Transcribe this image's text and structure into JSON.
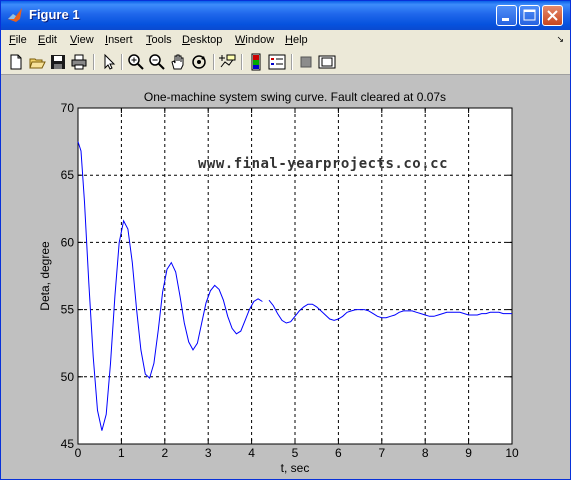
{
  "window": {
    "title": "Figure 1"
  },
  "menubar": {
    "items": [
      {
        "label": "File",
        "mnemonic": "F",
        "rest": "ile"
      },
      {
        "label": "Edit",
        "mnemonic": "E",
        "rest": "dit"
      },
      {
        "label": "View",
        "mnemonic": "V",
        "rest": "iew"
      },
      {
        "label": "Insert",
        "mnemonic": "I",
        "rest": "nsert"
      },
      {
        "label": "Tools",
        "mnemonic": "T",
        "rest": "ools"
      },
      {
        "label": "Desktop",
        "mnemonic": "D",
        "rest": "esktop"
      },
      {
        "label": "Window",
        "mnemonic": "W",
        "rest": "indow"
      },
      {
        "label": "Help",
        "mnemonic": "H",
        "rest": "elp"
      }
    ],
    "overflow_icon": "dock-arrow-icon"
  },
  "toolbar": {
    "buttons": [
      "new-figure-icon",
      "open-file-icon",
      "save-icon",
      "print-icon",
      "edit-plot-icon",
      "zoom-in-icon",
      "zoom-out-icon",
      "pan-icon",
      "rotate-3d-icon",
      "data-cursor-icon",
      "colorbar-icon",
      "legend-icon",
      "hide-plot-tools-icon",
      "show-plot-tools-icon"
    ]
  },
  "watermark": "www.final-yearprojects.co.cc",
  "chart_data": {
    "type": "line",
    "title": "One-machine system swing curve. Fault cleared at 0.07s",
    "xlabel": "t, sec",
    "ylabel": "Deta, degree",
    "xlim": [
      0,
      10
    ],
    "ylim": [
      45,
      70
    ],
    "xticks": [
      0,
      1,
      2,
      3,
      4,
      5,
      6,
      7,
      8,
      9,
      10
    ],
    "yticks": [
      45,
      50,
      55,
      60,
      65,
      70
    ],
    "grid": true,
    "line_color": "#0000FF",
    "series": [
      {
        "points": [
          [
            0,
            67.5
          ],
          [
            0.07,
            66.8
          ],
          [
            0.15,
            63.0
          ],
          [
            0.25,
            57.0
          ],
          [
            0.35,
            51.5
          ],
          [
            0.45,
            47.5
          ],
          [
            0.55,
            46.0
          ],
          [
            0.65,
            47.2
          ],
          [
            0.75,
            51.0
          ],
          [
            0.85,
            56.0
          ],
          [
            0.95,
            60.0
          ],
          [
            1.05,
            61.6
          ],
          [
            1.15,
            61.0
          ],
          [
            1.25,
            58.5
          ],
          [
            1.35,
            55.0
          ],
          [
            1.45,
            52.0
          ],
          [
            1.55,
            50.2
          ],
          [
            1.65,
            49.9
          ],
          [
            1.75,
            51.0
          ],
          [
            1.85,
            53.5
          ],
          [
            1.95,
            56.3
          ],
          [
            2.05,
            58.0
          ],
          [
            2.15,
            58.5
          ],
          [
            2.25,
            57.8
          ],
          [
            2.35,
            56.0
          ],
          [
            2.45,
            54.0
          ],
          [
            2.55,
            52.6
          ],
          [
            2.65,
            52.0
          ],
          [
            2.75,
            52.5
          ],
          [
            2.85,
            54.0
          ],
          [
            2.95,
            55.5
          ],
          [
            3.05,
            56.4
          ],
          [
            3.15,
            56.8
          ],
          [
            3.25,
            56.5
          ],
          [
            3.35,
            55.7
          ],
          [
            3.45,
            54.5
          ],
          [
            3.55,
            53.6
          ],
          [
            3.65,
            53.2
          ],
          [
            3.75,
            53.4
          ],
          [
            3.85,
            54.2
          ],
          [
            3.95,
            55.0
          ],
          [
            4.05,
            55.6
          ],
          [
            4.15,
            55.8
          ],
          [
            4.25,
            55.6
          ],
          null,
          [
            4.4,
            55.7
          ],
          [
            4.5,
            55.3
          ],
          [
            4.6,
            54.7
          ],
          [
            4.7,
            54.2
          ],
          [
            4.8,
            54.0
          ],
          [
            4.9,
            54.1
          ],
          [
            5.0,
            54.5
          ],
          [
            5.1,
            54.9
          ],
          [
            5.2,
            55.2
          ],
          [
            5.3,
            55.4
          ],
          [
            5.4,
            55.4
          ],
          [
            5.5,
            55.2
          ],
          [
            5.6,
            54.9
          ],
          [
            5.7,
            54.6
          ],
          [
            5.8,
            54.3
          ],
          [
            5.9,
            54.2
          ],
          [
            6.0,
            54.3
          ],
          [
            6.1,
            54.5
          ],
          [
            6.2,
            54.8
          ],
          [
            6.3,
            54.9
          ],
          [
            6.4,
            55.0
          ],
          [
            6.5,
            55.0
          ],
          [
            6.6,
            55.0
          ],
          [
            6.7,
            54.9
          ],
          [
            6.8,
            54.7
          ],
          [
            6.9,
            54.5
          ],
          [
            7.0,
            54.4
          ],
          [
            7.1,
            54.4
          ],
          [
            7.2,
            54.5
          ],
          [
            7.3,
            54.6
          ],
          [
            7.4,
            54.8
          ],
          [
            7.5,
            54.9
          ],
          [
            7.6,
            54.9
          ],
          [
            7.7,
            54.9
          ],
          [
            7.8,
            54.8
          ],
          [
            7.9,
            54.7
          ],
          [
            8.0,
            54.6
          ],
          [
            8.1,
            54.5
          ],
          [
            8.2,
            54.5
          ],
          [
            8.3,
            54.6
          ],
          [
            8.4,
            54.7
          ],
          [
            8.5,
            54.8
          ],
          [
            8.6,
            54.8
          ],
          [
            8.7,
            54.8
          ],
          [
            8.8,
            54.8
          ],
          [
            8.9,
            54.7
          ],
          [
            9.0,
            54.6
          ],
          [
            9.1,
            54.6
          ],
          [
            9.2,
            54.6
          ],
          [
            9.3,
            54.7
          ],
          [
            9.4,
            54.7
          ],
          [
            9.5,
            54.8
          ],
          [
            9.6,
            54.8
          ],
          [
            9.7,
            54.8
          ],
          [
            9.8,
            54.7
          ],
          [
            9.9,
            54.7
          ],
          [
            10.0,
            54.7
          ]
        ]
      }
    ]
  }
}
